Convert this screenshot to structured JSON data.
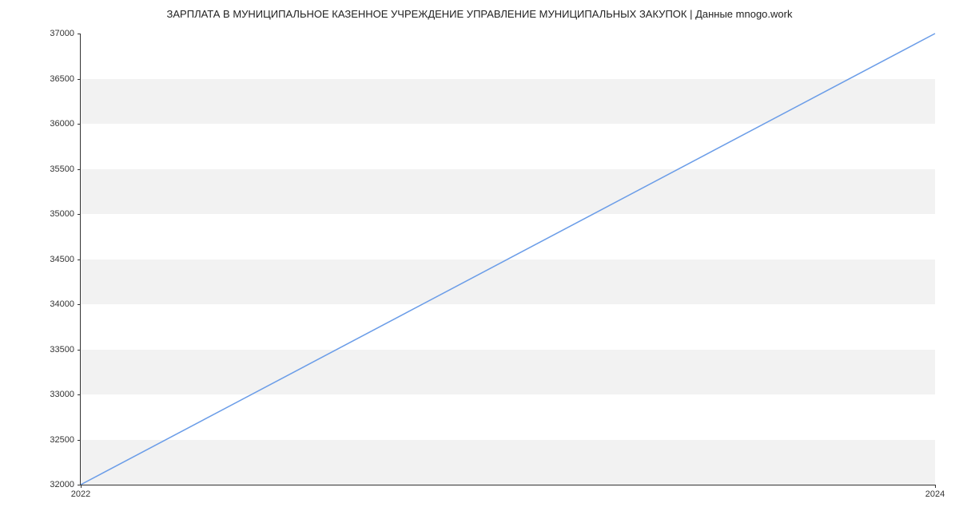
{
  "chart_data": {
    "type": "line",
    "title": "ЗАРПЛАТА В МУНИЦИПАЛЬНОЕ КАЗЕННОЕ УЧРЕЖДЕНИЕ УПРАВЛЕНИЕ МУНИЦИПАЛЬНЫХ ЗАКУПОК | Данные mnogo.work",
    "x": [
      2022,
      2024
    ],
    "values": [
      32000,
      37000
    ],
    "xlabel": "",
    "ylabel": "",
    "xlim": [
      2022,
      2024
    ],
    "ylim": [
      32000,
      37000
    ],
    "y_ticks": [
      32000,
      32500,
      33000,
      33500,
      34000,
      34500,
      35000,
      35500,
      36000,
      36500,
      37000
    ],
    "x_ticks": [
      2022,
      2024
    ],
    "line_color": "#6b9de8",
    "grid": "horizontal-bands"
  }
}
